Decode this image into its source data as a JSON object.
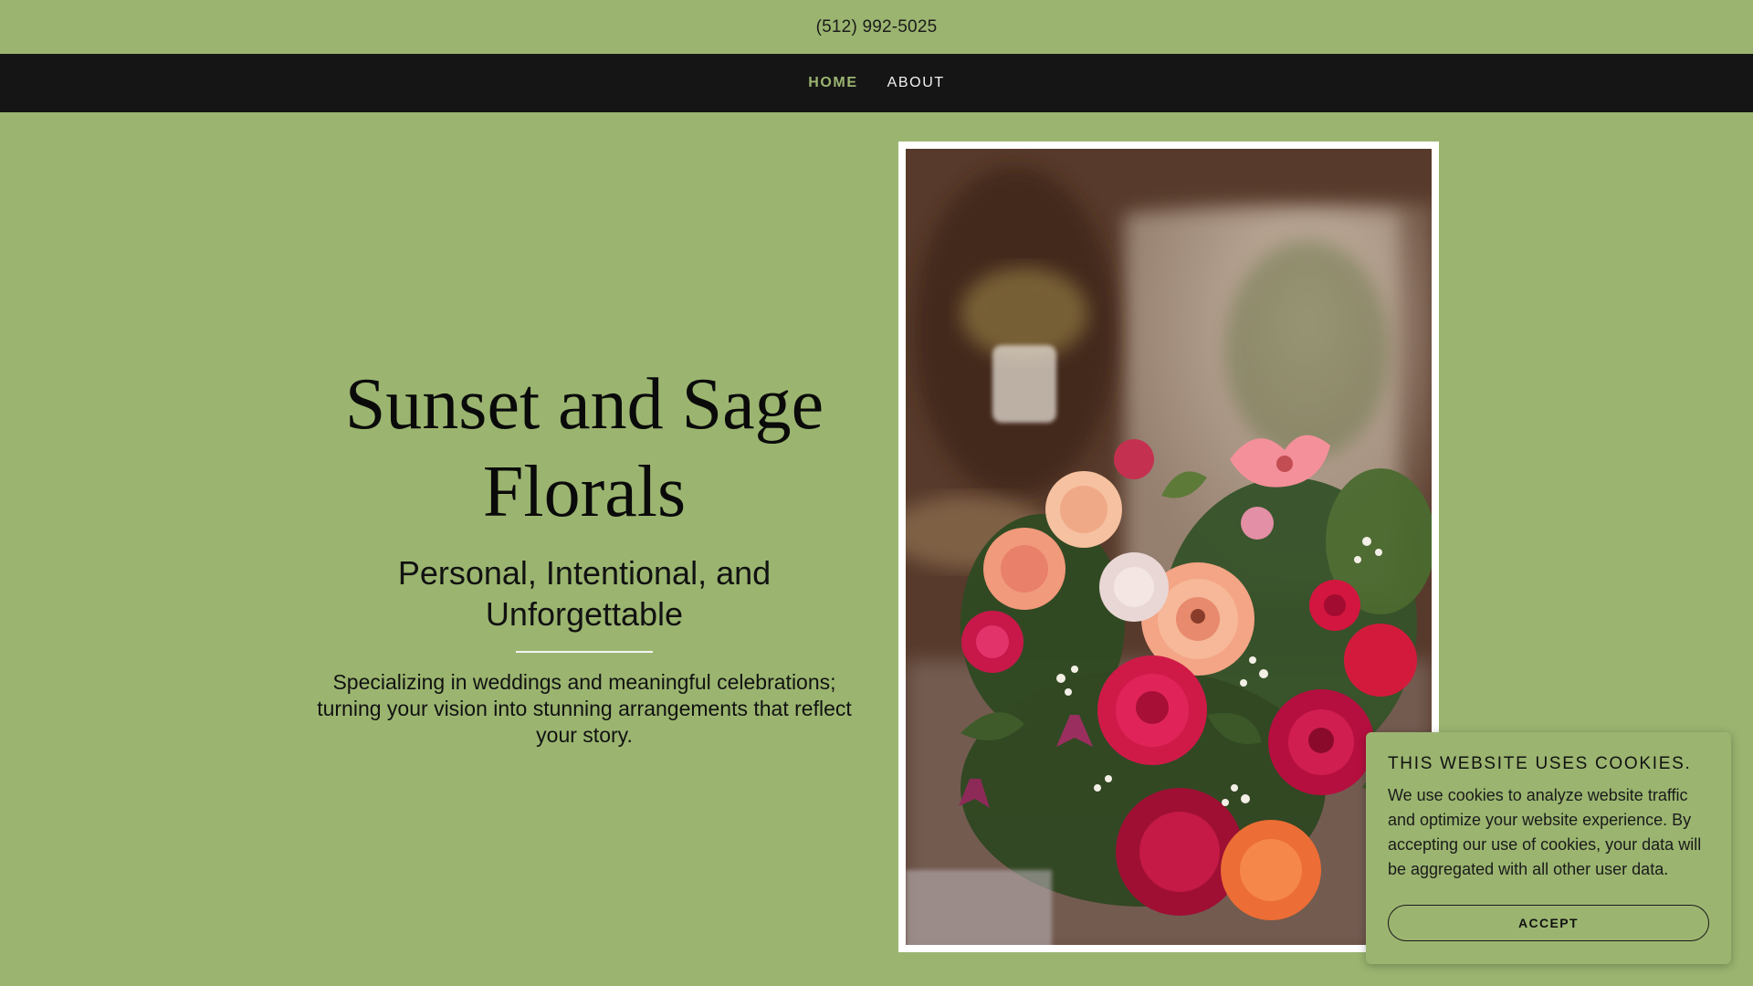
{
  "topbar": {
    "phone": "(512) 992-5025"
  },
  "nav": {
    "items": [
      {
        "label": "HOME",
        "active": true
      },
      {
        "label": "ABOUT",
        "active": false
      }
    ],
    "active_color": "#9bb570"
  },
  "hero": {
    "title": "Sunset and Sage Florals",
    "subtitle": "Personal, Intentional, and Unforgettable",
    "description": "Specializing in weddings and meaningful celebrations; turning your vision into stunning arrangements that reflect your story."
  },
  "image": {
    "subject": "floral bouquet photo"
  },
  "cookie_banner": {
    "title": "THIS WEBSITE USES COOKIES.",
    "text": "We use cookies to analyze website traffic and optimize your website experience. By accepting our use of cookies, your data will be aggregated with all other user data.",
    "accept_label": "ACCEPT"
  },
  "colors": {
    "background": "#9bb570",
    "navbar": "#151515",
    "frame": "#ffffff"
  }
}
